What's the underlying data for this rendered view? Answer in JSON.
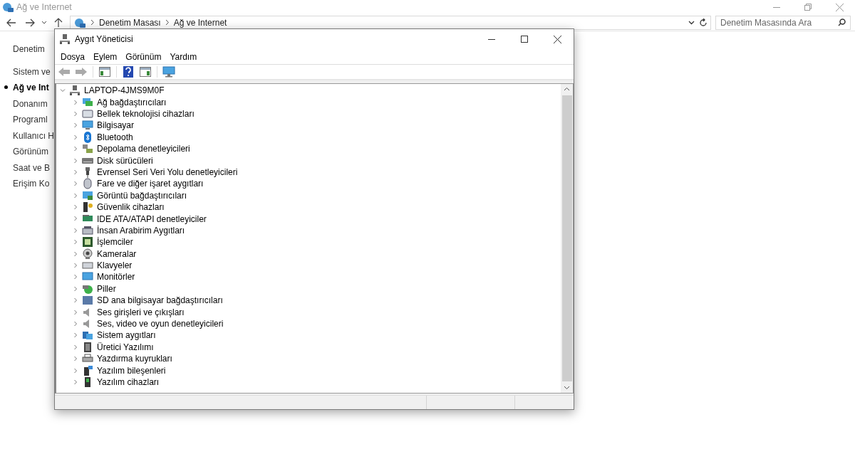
{
  "window": {
    "title": "Ağ ve Internet"
  },
  "address_bar": {
    "breadcrumbs": [
      "Denetim Masası",
      "Ağ ve Internet"
    ]
  },
  "search": {
    "placeholder": "Denetim Masasında Ara"
  },
  "sidebar": {
    "home": "Denetim",
    "items": [
      {
        "label": "Sistem ve",
        "selected": false
      },
      {
        "label": "Ağ ve Int",
        "selected": true
      },
      {
        "label": "Donanım",
        "selected": false
      },
      {
        "label": "Programl",
        "selected": false
      },
      {
        "label": "Kullanıcı H",
        "selected": false
      },
      {
        "label": "Görünüm",
        "selected": false
      },
      {
        "label": "Saat ve B",
        "selected": false
      },
      {
        "label": "Erişim Ko",
        "selected": false
      }
    ]
  },
  "device_manager": {
    "title": "Aygıt Yöneticisi",
    "menu": [
      "Dosya",
      "Eylem",
      "Görünüm",
      "Yardım"
    ],
    "tree": {
      "label": "LAPTOP-4JMS9M0F",
      "expanded": true,
      "children": [
        {
          "label": "Ağ bağdaştırıcıları",
          "expanded": false
        },
        {
          "label": "Bellek teknolojisi cihazları",
          "expanded": false
        },
        {
          "label": "Bilgisayar",
          "expanded": false
        },
        {
          "label": "Bluetooth",
          "expanded": false
        },
        {
          "label": "Depolama denetleyicileri",
          "expanded": false
        },
        {
          "label": "Disk sürücüleri",
          "expanded": false
        },
        {
          "label": "Evrensel Seri Veri Yolu denetleyicileri",
          "expanded": false
        },
        {
          "label": "Fare ve diğer işaret aygıtları",
          "expanded": false
        },
        {
          "label": "Görüntü bağdaştırıcıları",
          "expanded": false
        },
        {
          "label": "Güvenlik cihazları",
          "expanded": false
        },
        {
          "label": "IDE ATA/ATAPI denetleyiciler",
          "expanded": false
        },
        {
          "label": "İnsan Arabirim Aygıtları",
          "expanded": false
        },
        {
          "label": "İşlemciler",
          "expanded": false
        },
        {
          "label": "Kameralar",
          "expanded": false
        },
        {
          "label": "Klavyeler",
          "expanded": false
        },
        {
          "label": "Monitörler",
          "expanded": false
        },
        {
          "label": "Piller",
          "expanded": false
        },
        {
          "label": "SD ana bilgisayar bağdaştırıcıları",
          "expanded": false
        },
        {
          "label": "Ses girişleri ve çıkışları",
          "expanded": false
        },
        {
          "label": "Ses, video ve oyun denetleyicileri",
          "expanded": false
        },
        {
          "label": "Sistem aygıtları",
          "expanded": false
        },
        {
          "label": "Üretici Yazılımı",
          "expanded": false
        },
        {
          "label": "Yazdırma kuyrukları",
          "expanded": false
        },
        {
          "label": "Yazılım bileşenleri",
          "expanded": false
        },
        {
          "label": "Yazılım cihazları",
          "expanded": false
        }
      ]
    }
  }
}
